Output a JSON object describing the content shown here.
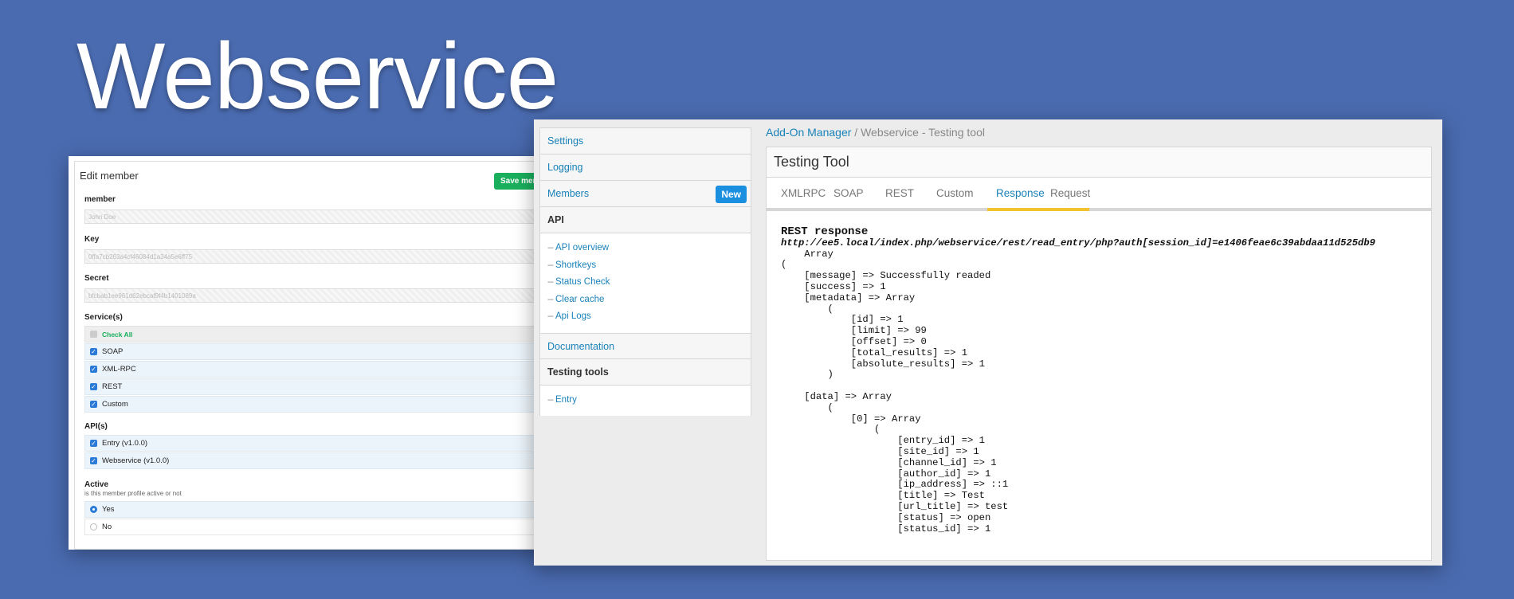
{
  "hero": {
    "title": "Webservice"
  },
  "edit_member": {
    "title": "Edit member",
    "save_label": "Save memb",
    "fields": [
      {
        "label": "member",
        "value": "John Doe"
      },
      {
        "label": "Key",
        "value": "0ffa7cb263a4cf46084d1a34a5e6ff75"
      },
      {
        "label": "Secret",
        "value": "bfcbab1ee961d62ebcaf9f4b1401089a"
      }
    ],
    "services": {
      "label": "Service(s)",
      "check_all": "Check All",
      "items": [
        "SOAP",
        "XML-RPC",
        "REST",
        "Custom"
      ]
    },
    "apis": {
      "label": "API(s)",
      "items": [
        "Entry (v1.0.0)",
        "Webservice (v1.0.0)"
      ]
    },
    "active": {
      "label": "Active",
      "description": "is this member profile active or not",
      "options": [
        "Yes",
        "No"
      ],
      "selected": "Yes"
    }
  },
  "sidebar": {
    "settings": "Settings",
    "logging": "Logging",
    "members": "Members",
    "new_button": "New",
    "api_header": "API",
    "api_links": [
      "API overview",
      "Shortkeys",
      "Status Check",
      "Clear cache",
      "Api Logs"
    ],
    "documentation": "Documentation",
    "testing_header": "Testing tools",
    "testing_links": [
      "Entry"
    ]
  },
  "breadcrumb": {
    "link": "Add-On Manager",
    "separator": " / ",
    "current": "Webservice - Testing tool"
  },
  "testing_tool": {
    "title": "Testing Tool",
    "tabs": [
      "XMLRPC",
      "SOAP",
      "REST",
      "Custom",
      "Response",
      "Request"
    ],
    "active_tab": "Response",
    "response_heading": "REST response",
    "response_url": "http://ee5.local/index.php/webservice/rest/read_entry/php?auth[session_id]=e1406feae6c39abdaa11d525db9",
    "response_body": "    Array\n(\n    [message] => Successfully readed\n    [success] => 1\n    [metadata] => Array\n        (\n            [id] => 1\n            [limit] => 99\n            [offset] => 0\n            [total_results] => 1\n            [absolute_results] => 1\n        )\n\n    [data] => Array\n        (\n            [0] => Array\n                (\n                    [entry_id] => 1\n                    [site_id] => 1\n                    [channel_id] => 1\n                    [author_id] => 1\n                    [ip_address] => ::1\n                    [title] => Test\n                    [url_title] => test\n                    [status] => open\n                    [status_id] => 1"
  },
  "colors": {
    "background": "#4a6bb0",
    "link": "#1a82b9",
    "save_green": "#1aaf5d",
    "new_blue": "#1a8fe0",
    "tab_underline": "#f2c230"
  }
}
